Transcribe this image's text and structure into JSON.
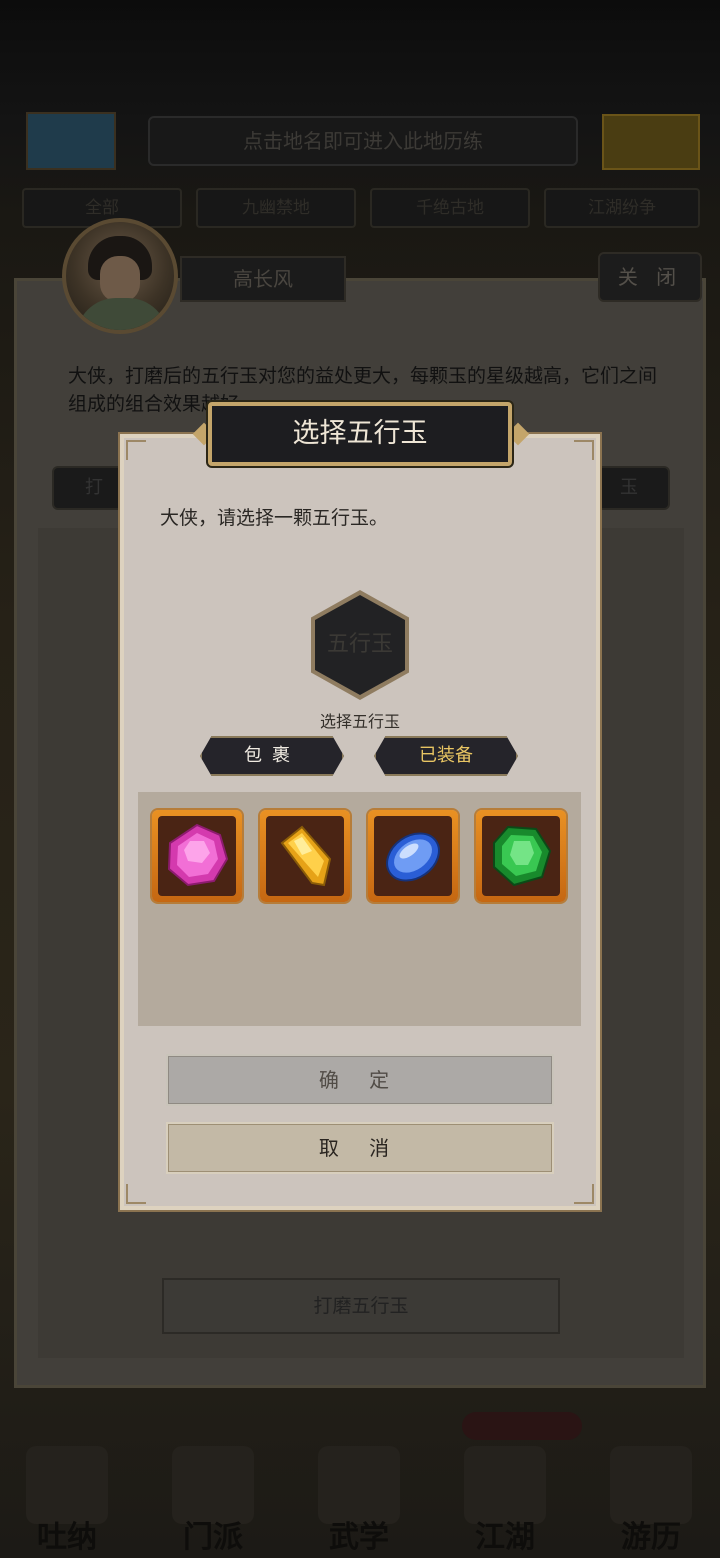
{
  "background": {
    "top_hint": "点击地名即可进入此地历练",
    "category_tabs": [
      "全部",
      "九幽禁地",
      "千绝古地",
      "江湖纷争"
    ],
    "character_name": "高长风",
    "close_label": "关 闭",
    "description": "大侠，打磨后的五行玉对您的益处更大，每颗玉的星级越高，它们之间组成的组合效果越好。",
    "tab_left_partial": "打",
    "tab_right_partial": "玉",
    "polish_button": "打磨五行玉",
    "nav": [
      "吐纳",
      "门派",
      "武学",
      "江湖",
      "游历"
    ]
  },
  "modal": {
    "title": "选择五行玉",
    "prompt": "大侠，请选择一颗五行玉。",
    "slot_text": "五行玉",
    "slot_label": "选择五行玉",
    "tabs": {
      "bag": "包裹",
      "equipped": "已装备"
    },
    "gems": [
      {
        "icon": "pink-gem-icon",
        "color": "#e24fc0"
      },
      {
        "icon": "yellow-gem-icon",
        "color": "#f1b21e"
      },
      {
        "icon": "blue-gem-icon",
        "color": "#3f76e6"
      },
      {
        "icon": "green-gem-icon",
        "color": "#21a33a"
      }
    ],
    "confirm": "确 定",
    "cancel": "取 消"
  }
}
